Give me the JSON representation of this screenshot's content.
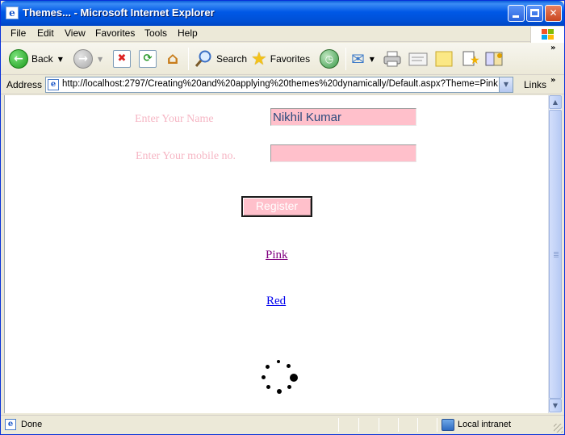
{
  "window": {
    "title": "Themes... - Microsoft Internet Explorer",
    "title_icon": "ie-page-icon"
  },
  "menu": {
    "items": [
      "File",
      "Edit",
      "View",
      "Favorites",
      "Tools",
      "Help"
    ]
  },
  "toolbar": {
    "back_label": "Back",
    "search_label": "Search",
    "favorites_label": "Favorites",
    "icons": [
      "back-icon",
      "forward-icon",
      "stop-icon",
      "refresh-icon",
      "home-icon",
      "search-icon",
      "favorites-star-icon",
      "history-icon",
      "mail-icon",
      "print-icon",
      "edit-icon",
      "discuss-icon",
      "messenger-icon",
      "research-icon"
    ]
  },
  "address": {
    "label": "Address",
    "url": "http://localhost:2797/Creating%20and%20applying%20themes%20dynamically/Default.aspx?Theme=Pink",
    "links_label": "Links"
  },
  "form": {
    "name_label": "Enter Your Name",
    "name_value": "Nikhil Kumar",
    "mobile_label": "Enter Your mobile no.",
    "mobile_value": "",
    "register_label": "Register",
    "label_color": "#f6b6c4",
    "input_bg": "#ffc0cb"
  },
  "links": {
    "pink": "Pink",
    "red": "Red",
    "visited_color": "#800080",
    "link_color": "#0000ee"
  },
  "status": {
    "text": "Done",
    "zone": "Local intranet"
  }
}
